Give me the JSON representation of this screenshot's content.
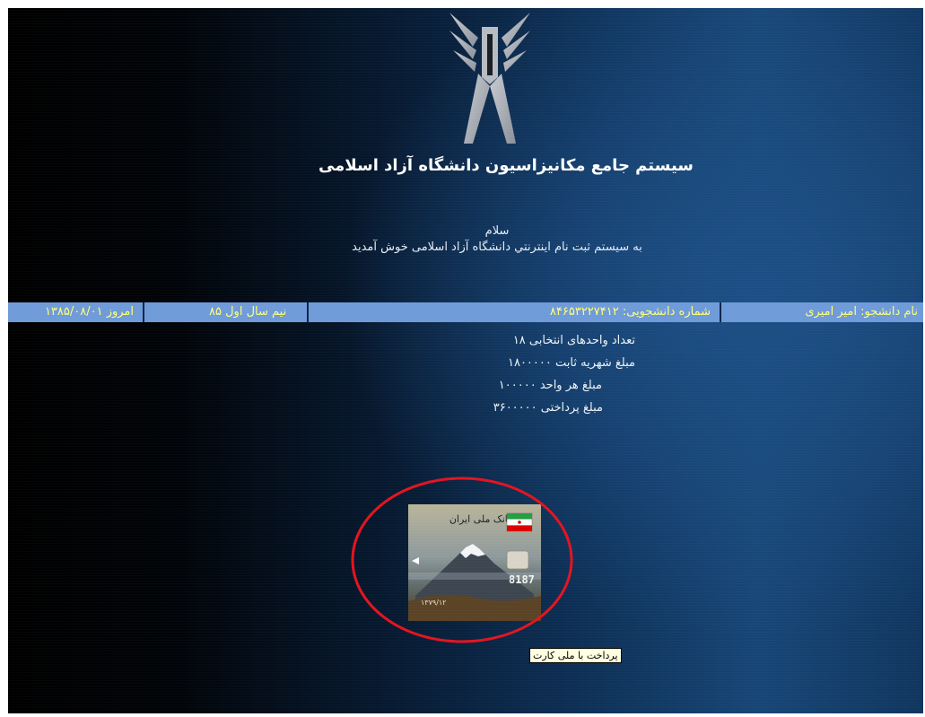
{
  "header": {
    "system_title": "سیستم جامع مکانیزاسیون دانشگاه آزاد اسلامی",
    "greeting": "سلام",
    "welcome": "به سیستم ثبت نام اینترنتي دانشگاه آزاد اسلامی خوش آمدید"
  },
  "info_bar": {
    "date": "امروز ۱۳۸۵/۰۸/۰۱",
    "term": "نیم سال اول ۸۵",
    "student_number": "شماره دانشجویی: ۸۴۶۵۳۲۲۷۴۱۲",
    "student_name": "نام دانشجو: امیر امیری"
  },
  "details": {
    "units_selected": "تعداد واحدهای انتخابی ۱۸",
    "fixed_tuition": "مبلغ شهریه ثابت ۱۸۰۰۰۰۰",
    "per_unit": "مبلغ هر واحد ۱۰۰۰۰۰",
    "payable": "مبلغ پرداختی ۳۶۰۰۰۰۰"
  },
  "card": {
    "bank_name": "بانک ملی ایران",
    "number_fragment": "8187",
    "expiry": "۱۳۷۹/۱۲"
  },
  "tooltip": "پرداخت با ملی کارت",
  "colors": {
    "bar_background": "#6f9bd9",
    "bar_text": "#ffff7a",
    "ring": "#e3141f",
    "tooltip_bg": "#ffffe1"
  },
  "icons": {
    "logo": "azad-university-logo",
    "card_pointer": "pointer-triangle-icon"
  }
}
